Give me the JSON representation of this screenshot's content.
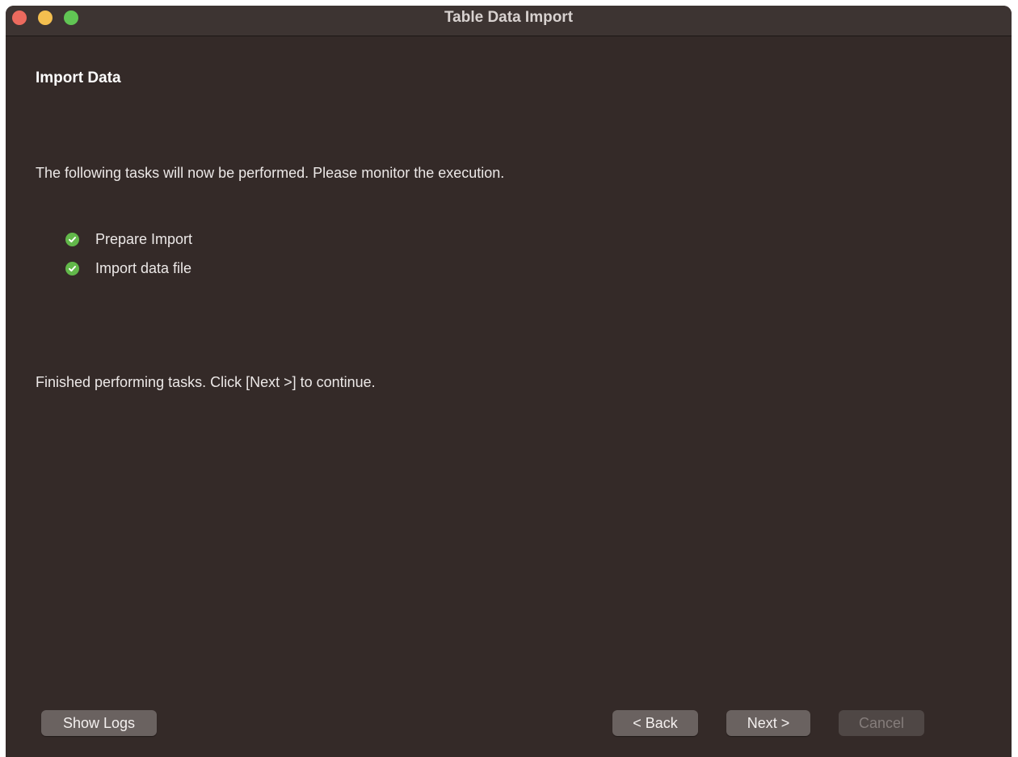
{
  "window": {
    "title": "Table Data Import"
  },
  "page": {
    "heading": "Import Data",
    "intro": "The following tasks will now be performed. Please monitor the execution.",
    "tasks": [
      {
        "label": "Prepare Import",
        "status": "done",
        "icon": "check-circle-icon"
      },
      {
        "label": "Import data file",
        "status": "done",
        "icon": "check-circle-icon"
      }
    ],
    "finished_message": "Finished performing tasks. Click [Next >] to continue."
  },
  "footer": {
    "show_logs_label": "Show Logs",
    "back_label": "< Back",
    "next_label": "Next >",
    "cancel_label": "Cancel",
    "cancel_enabled": false
  },
  "colors": {
    "background": "#342a28",
    "titlebar": "#3d3432",
    "success": "#62b84a",
    "button": "#6a6260",
    "button_disabled": "#4f4745"
  }
}
